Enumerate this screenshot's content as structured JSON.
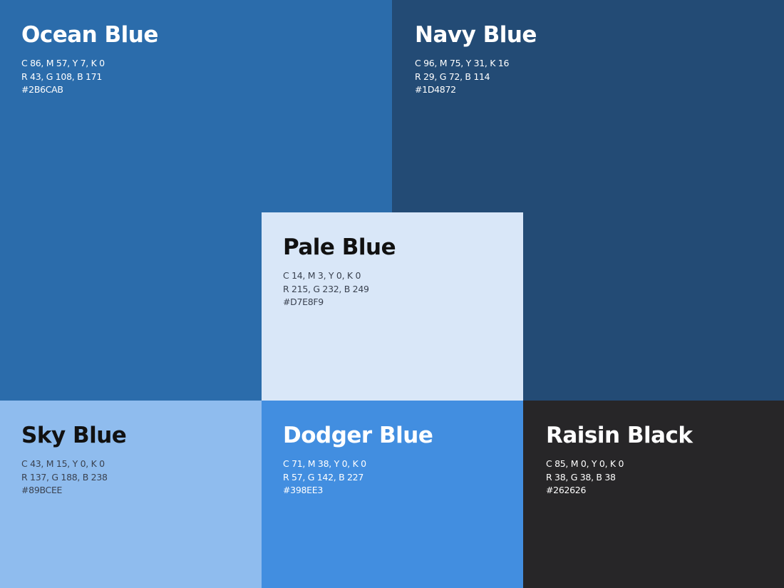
{
  "swatches": [
    {
      "id": "ocean",
      "name": "Ocean Blue",
      "cmyk": "C 86, M 57, Y 7, K 0",
      "rgb": "R 43, G 108, B 171",
      "hex": "#2B6CAB",
      "color": "#2B6CAB"
    },
    {
      "id": "navy",
      "name": "Navy Blue",
      "cmyk": "C 96, M 75, Y 31, K 16",
      "rgb": "R 29, G 72, B 114",
      "hex": "#1D4872",
      "color": "#234B75"
    },
    {
      "id": "pale",
      "name": "Pale Blue",
      "cmyk": "C 14, M 3, Y 0, K 0",
      "rgb": "R 215, G 232, B 249",
      "hex": "#D7E8F9",
      "color": "#D9E7F8"
    },
    {
      "id": "sky",
      "name": "Sky Blue",
      "cmyk": "C 43, M 15, Y 0, K 0",
      "rgb": "R 137, G 188, B 238",
      "hex": "#89BCEE",
      "color": "#8FBCEE"
    },
    {
      "id": "dodger",
      "name": "Dodger Blue",
      "cmyk": "C 71, M 38, Y 0, K 0",
      "rgb": "R 57, G 142, B 227",
      "hex": "#398EE3",
      "color": "#428EE0"
    },
    {
      "id": "raisin",
      "name": "Raisin Black",
      "cmyk": "C 85, M 0, Y 0, K 0",
      "rgb": "R 38, G 38, B 38",
      "hex": "#262626",
      "color": "#272628"
    }
  ]
}
